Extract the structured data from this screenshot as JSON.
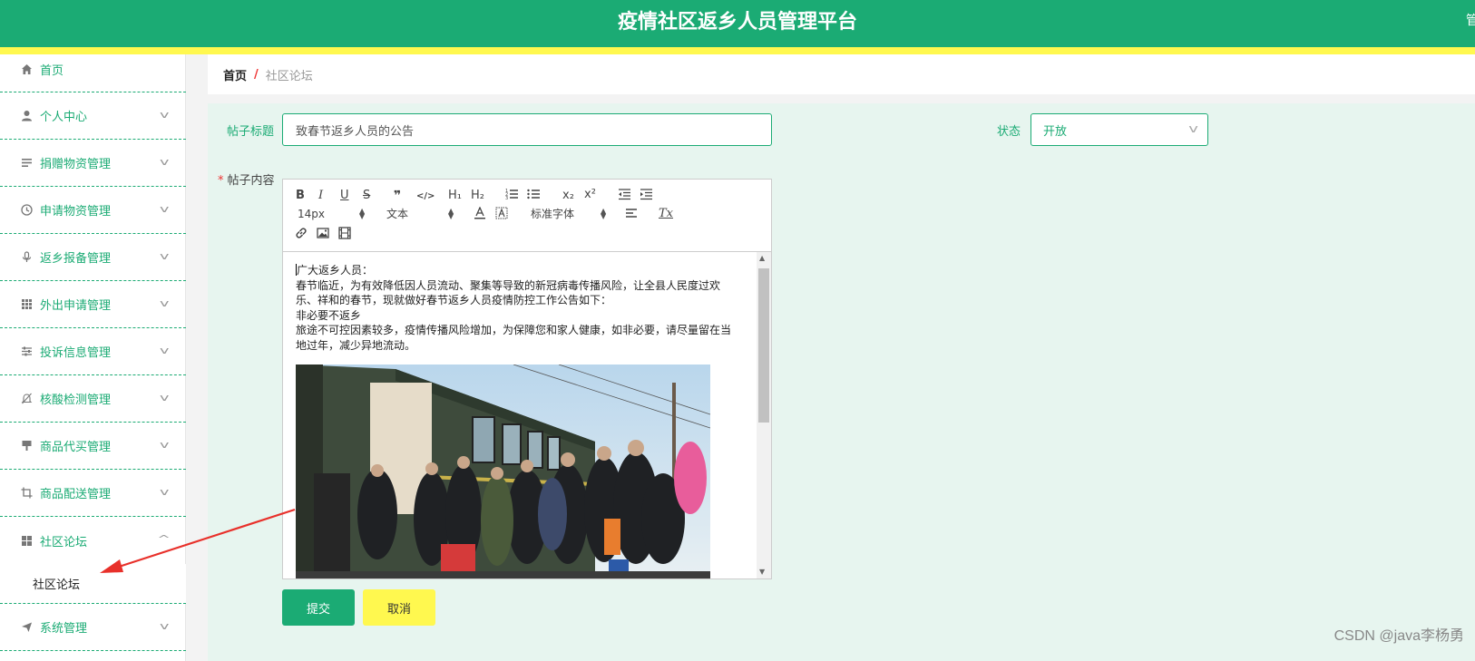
{
  "header": {
    "title": "疫情社区返乡人员管理平台",
    "right_text": "管"
  },
  "sidebar": {
    "items": [
      {
        "label": "首页",
        "icon": "home-icon"
      },
      {
        "label": "个人中心",
        "icon": "user-icon"
      },
      {
        "label": "捐赠物资管理",
        "icon": "list-icon"
      },
      {
        "label": "申请物资管理",
        "icon": "clock-icon"
      },
      {
        "label": "返乡报备管理",
        "icon": "microphone-icon"
      },
      {
        "label": "外出申请管理",
        "icon": "grid-icon"
      },
      {
        "label": "投诉信息管理",
        "icon": "sliders-icon"
      },
      {
        "label": "核酸检测管理",
        "icon": "bell-off-icon"
      },
      {
        "label": "商品代买管理",
        "icon": "brush-icon"
      },
      {
        "label": "商品配送管理",
        "icon": "crop-icon"
      },
      {
        "label": "社区论坛",
        "icon": "apps-icon"
      },
      {
        "label": "系统管理",
        "icon": "send-icon"
      }
    ],
    "sub_item": "社区论坛"
  },
  "breadcrumb": {
    "home": "首页",
    "separator": "/",
    "current": "社区论坛"
  },
  "form": {
    "title_label": "帖子标题",
    "title_value": "致春节返乡人员的公告",
    "status_label": "状态",
    "status_value": "开放",
    "content_label": "帖子内容",
    "required_mark": "*"
  },
  "toolbar": {
    "bold": "B",
    "italic": "I",
    "underline": "U",
    "strike": "S",
    "quote": "❞",
    "code": "</>",
    "h1": "H₁",
    "h2": "H₂",
    "subscript": "x₂",
    "superscript": "x²",
    "size": "14px",
    "header_select": "文本",
    "font_select": "标准字体",
    "clean": "Tx"
  },
  "editor": {
    "lines": [
      "广大返乡人员：",
      "春节临近，为有效降低因人员流动、聚集等导致的新冠病毒传播风险，让全县人民度过欢乐、祥和的春节，现就做好春节返乡人员疫情防控工作公告如下：",
      "非必要不返乡",
      "旅途不可控因素较多，疫情传播风险增加，为保障您和家人健康，如非必要，请尽量留在当地过年，减少异地流动。"
    ]
  },
  "buttons": {
    "submit": "提交",
    "cancel": "取消"
  },
  "watermark": "CSDN @java李杨勇",
  "colors": {
    "primary": "#1bab74",
    "accent_yellow": "#fff84f",
    "panel_bg": "#e7f5ef"
  }
}
